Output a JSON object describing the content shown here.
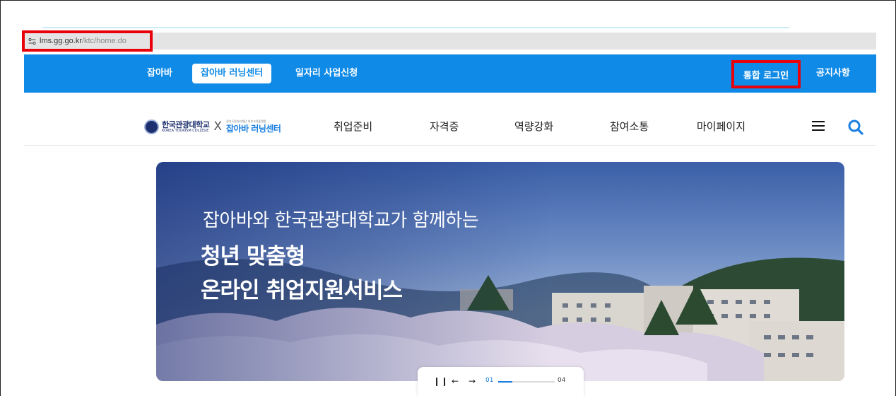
{
  "browser": {
    "url_host": "lms.gg.go.kr",
    "url_path": "/ktc/home.do"
  },
  "topbar": {
    "items": [
      "잡아바",
      "잡아바 러닝센터",
      "일자리 사업신청"
    ],
    "login": "통합 로그인",
    "notice": "공지사항",
    "color": "#0f8ae6"
  },
  "header": {
    "logo_ktc_kr": "한국관광대학교",
    "logo_ktc_en": "KOREA TOURISM COLLEGE",
    "logo_x": "X",
    "logo_jab_small": "경기도일자리재단 외부교육플랫폼",
    "logo_jab_main": "잡아바 러닝센터",
    "menu": [
      "취업준비",
      "자격증",
      "역량강화",
      "참여소통",
      "마이페이지"
    ]
  },
  "banner": {
    "subtitle": "잡아바와 한국관광대학교가 함께하는",
    "title_line1": "청년 맞춤형",
    "title_line2": "온라인 취업지원서비스"
  },
  "slider": {
    "current": "01",
    "total": "04",
    "progress": 0.25
  }
}
